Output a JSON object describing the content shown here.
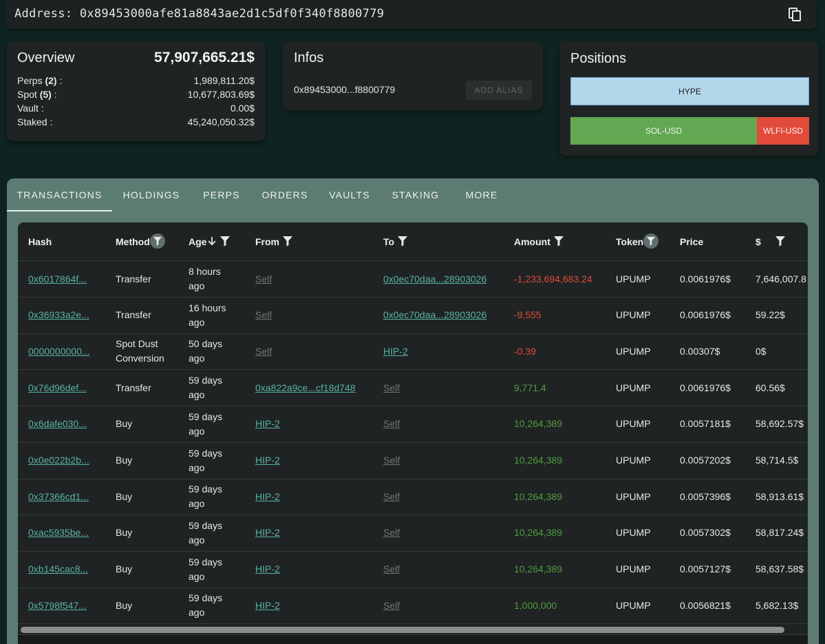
{
  "address": {
    "label": "Address:",
    "value": "0x89453000afe81a8843ae2d1c5df0f340f8800779"
  },
  "overview": {
    "title": "Overview",
    "total": "57,907,665.21$",
    "rows": [
      {
        "label": "Perps",
        "count": "(2)",
        "suffix": " :",
        "value": "1,989,811.20$"
      },
      {
        "label": "Spot",
        "count": "(5)",
        "suffix": " :",
        "value": "10,677,803.69$"
      },
      {
        "label": "Vault :",
        "count": "",
        "suffix": "",
        "value": "0.00$"
      },
      {
        "label": "Staked :",
        "count": "",
        "suffix": "",
        "value": "45,240,050.32$"
      }
    ]
  },
  "infos": {
    "title": "Infos",
    "short_address": "0x89453000...f8800779",
    "alias_button": "ADD ALIAS"
  },
  "positions": {
    "title": "Positions",
    "items": [
      {
        "label": "HYPE",
        "color": "#b3d6ea"
      },
      {
        "label": "SOL-USD",
        "color": "#62a852"
      },
      {
        "label": "WLFI-USD",
        "color": "#e24a3a"
      }
    ]
  },
  "tabs": [
    "TRANSACTIONS",
    "HOLDINGS",
    "PERPS",
    "ORDERS",
    "VAULTS",
    "STAKING",
    "MORE"
  ],
  "table": {
    "headers": [
      "Hash",
      "Method",
      "Age",
      "From",
      "To",
      "Amount",
      "Token",
      "Price",
      "$"
    ],
    "rows": [
      {
        "hash": "0x6017864f...",
        "method": "Transfer",
        "age": "8 hours ago",
        "from": "Self",
        "to": "0x0ec70daa...28903026",
        "amount": "-1,233,694,683.24",
        "token": "UPUMP",
        "price": "0.0061976$",
        "usd": "7,646,007.8"
      },
      {
        "hash": "0x36933a2e...",
        "method": "Transfer",
        "age": "16 hours ago",
        "from": "Self",
        "to": "0x0ec70daa...28903026",
        "amount": "-9,555",
        "token": "UPUMP",
        "price": "0.0061976$",
        "usd": "59.22$"
      },
      {
        "hash": "0000000000...",
        "method": "Spot Dust Conversion",
        "age": "50 days ago",
        "from": "Self",
        "to": "HIP-2",
        "amount": "-0.39",
        "token": "UPUMP",
        "price": "0.00307$",
        "usd": "0$"
      },
      {
        "hash": "0x76d96def...",
        "method": "Transfer",
        "age": "59 days ago",
        "from": "0xa822a9ce...cf18d748",
        "to": "Self",
        "amount": "9,771.4",
        "token": "UPUMP",
        "price": "0.0061976$",
        "usd": "60.56$"
      },
      {
        "hash": "0x6dafe030...",
        "method": "Buy",
        "age": "59 days ago",
        "from": "HIP-2",
        "to": "Self",
        "amount": "10,264,389",
        "token": "UPUMP",
        "price": "0.0057181$",
        "usd": "58,692.57$"
      },
      {
        "hash": "0x0e022b2b...",
        "method": "Buy",
        "age": "59 days ago",
        "from": "HIP-2",
        "to": "Self",
        "amount": "10,264,389",
        "token": "UPUMP",
        "price": "0.0057202$",
        "usd": "58,714.5$"
      },
      {
        "hash": "0x37366cd1...",
        "method": "Buy",
        "age": "59 days ago",
        "from": "HIP-2",
        "to": "Self",
        "amount": "10,264,389",
        "token": "UPUMP",
        "price": "0.0057396$",
        "usd": "58,913.61$"
      },
      {
        "hash": "0xac5935be...",
        "method": "Buy",
        "age": "59 days ago",
        "from": "HIP-2",
        "to": "Self",
        "amount": "10,264,389",
        "token": "UPUMP",
        "price": "0.0057302$",
        "usd": "58,817.24$"
      },
      {
        "hash": "0xb145cac8...",
        "method": "Buy",
        "age": "59 days ago",
        "from": "HIP-2",
        "to": "Self",
        "amount": "10,264,389",
        "token": "UPUMP",
        "price": "0.0057127$",
        "usd": "58,637.58$"
      },
      {
        "hash": "0x5798f547...",
        "method": "Buy",
        "age": "59 days ago",
        "from": "HIP-2",
        "to": "Self",
        "amount": "1,000,000",
        "token": "UPUMP",
        "price": "0.0056821$",
        "usd": "5,682.13$"
      }
    ]
  },
  "colors": {
    "accent": "#59b3a5",
    "negative": "#e04a3c",
    "positive": "#4f9d3f",
    "panel": "#5b7b73"
  }
}
